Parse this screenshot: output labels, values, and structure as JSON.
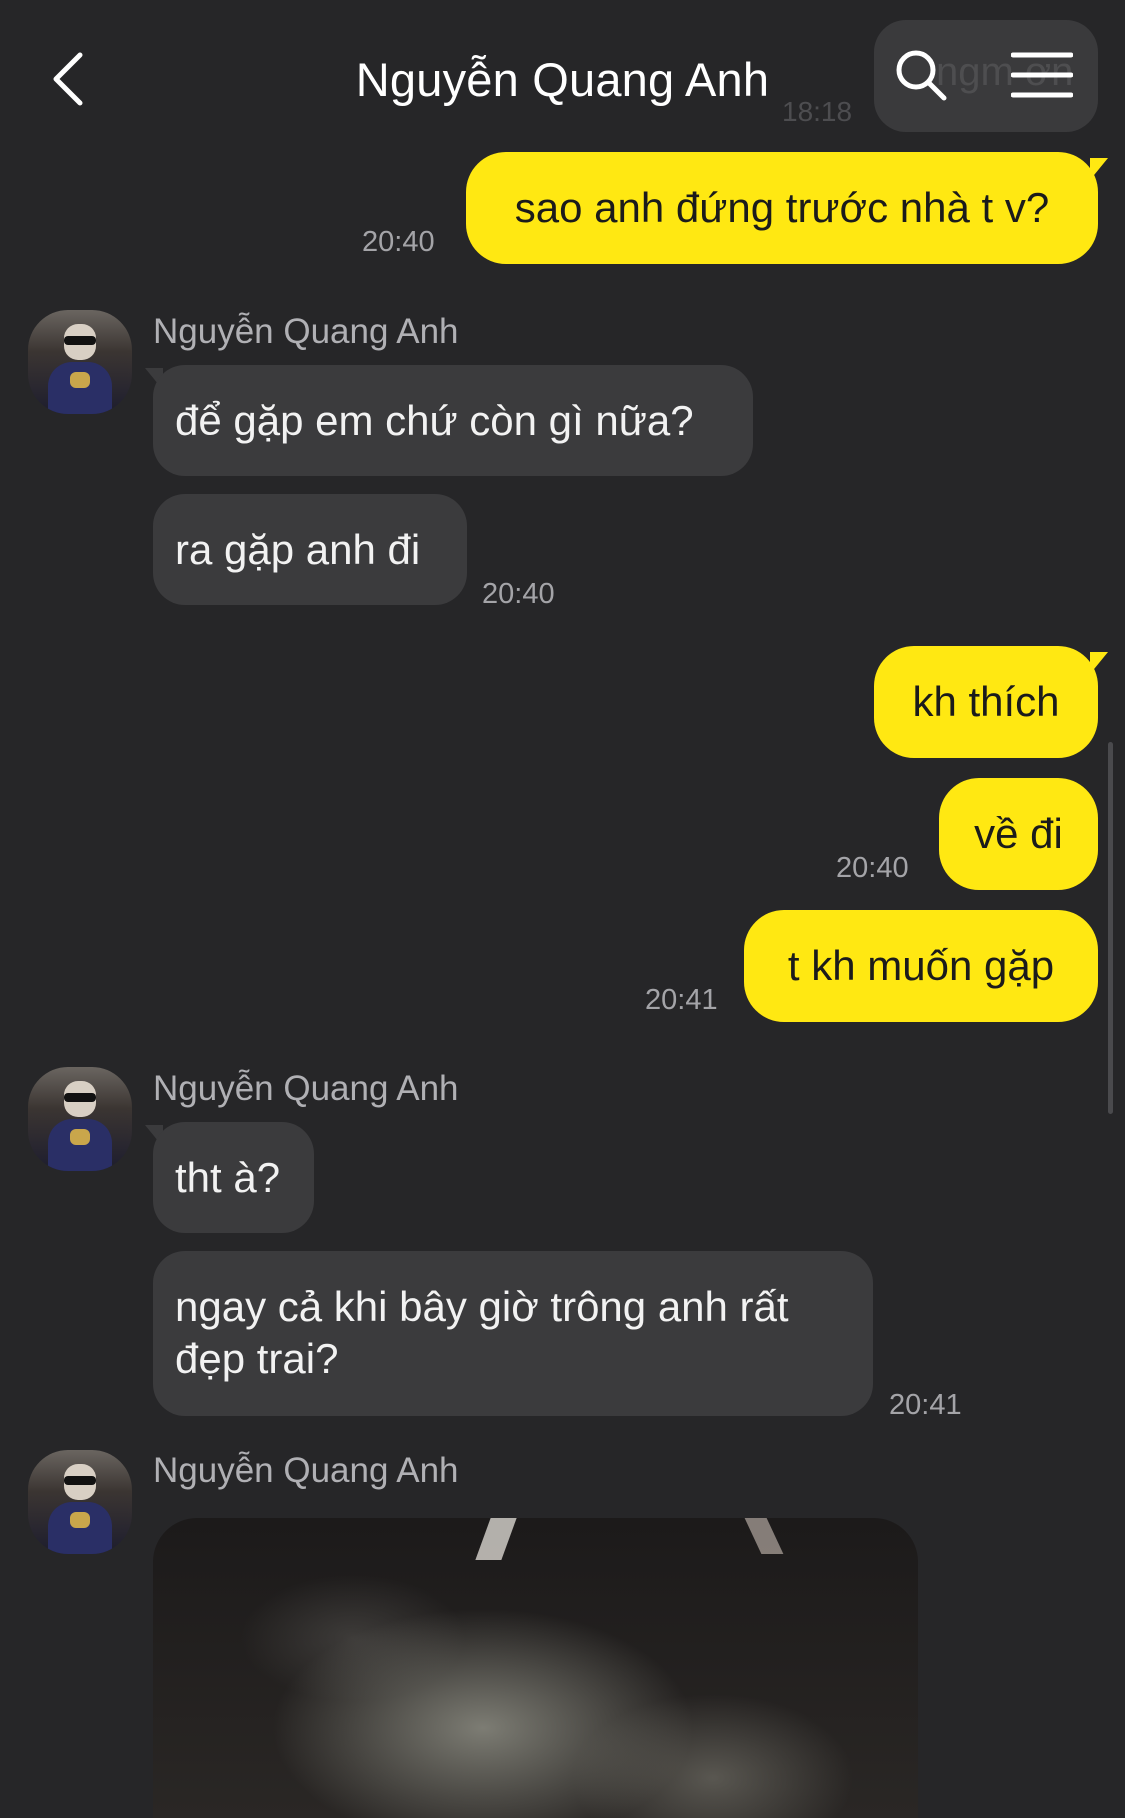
{
  "header": {
    "title": "Nguyễn Quang Anh",
    "back_icon": "chevron-left-icon",
    "search_icon": "search-icon",
    "menu_icon": "hamburger-menu-icon",
    "partial_time_behind": "18:18",
    "partial_text_behind": "ngm ơn"
  },
  "colors": {
    "background": "#262628",
    "outgoing_bubble": "#ffe812",
    "incoming_bubble": "#3b3b3d",
    "timestamp": "#a4a4a8"
  },
  "messages": {
    "m1": {
      "text": "sao anh đứng trước nhà t v?",
      "time": "20:40"
    },
    "g1": {
      "sender": "Nguyễn Quang Anh",
      "m2": {
        "text": "để gặp em chứ còn gì nữa?"
      },
      "m3": {
        "text": "ra gặp anh đi",
        "time": "20:40"
      }
    },
    "m4": {
      "text": "kh thích"
    },
    "m5": {
      "text": "về đi",
      "time": "20:40"
    },
    "m6": {
      "text": "t kh muốn gặp",
      "time": "20:41"
    },
    "g2": {
      "sender": "Nguyễn Quang Anh",
      "m7": {
        "text": "tht à?"
      },
      "m8": {
        "text": "ngay cả khi bây giờ trông anh rất đẹp trai?",
        "time": "20:41"
      }
    },
    "g3": {
      "sender": "Nguyễn Quang Anh",
      "photo": "image-message"
    }
  }
}
